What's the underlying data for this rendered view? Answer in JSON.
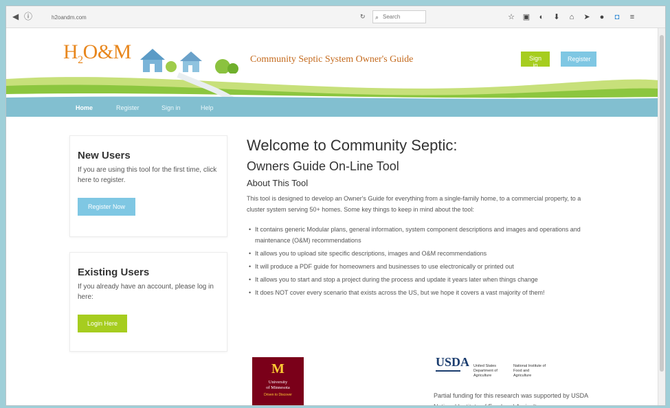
{
  "browser": {
    "url": "h2oandm.com",
    "search_placeholder": "Search"
  },
  "site": {
    "logo": "H₂O&M",
    "tagline": "Community Septic System Owner's Guide",
    "signin_label": "Sign in",
    "register_label": "Register"
  },
  "nav": {
    "items": [
      "Home",
      "Register",
      "Sign in",
      "Help"
    ]
  },
  "new_users": {
    "title": "New Users",
    "text": "If you are using this tool for the first time, click here to register.",
    "button": "Register Now"
  },
  "existing_users": {
    "title": "Existing Users",
    "text": "If you already have an account, please log in here:",
    "button": "Login Here"
  },
  "main": {
    "heading1": "Welcome to Community Septic:",
    "heading2": "Owners Guide On-Line Tool",
    "heading3": "About This Tool",
    "intro": "This tool is designed to develop an Owner's Guide for everything from a single-family home, to a commercial property, to a cluster system serving 50+ homes. Some key things to keep in mind about the tool:",
    "bullets": [
      "It contains generic Modular plans, general information, system component descriptions and images and operations and maintenance (O&M) recommendations",
      "It allows you to upload site specific descriptions, images and O&M recommendations",
      "It will produce a PDF guide for homeowners and businesses to use electronically or printed out",
      "It allows you to start and stop a project during the process and update it years later when things change",
      "It does NOT cover every scenario that exists across the US, but we hope it covers a vast majority of them!"
    ]
  },
  "footer": {
    "umn_name_line1": "University",
    "umn_name_line2": "of Minnesota",
    "umn_slogan": "Driven to Discover",
    "usda": "USDA",
    "usda_dept": "United States Department of Agriculture",
    "nifa": "National Institute of Food and Agriculture",
    "funding": "Partial funding for this research was supported by USDA National Institute of Food and Agriculture"
  },
  "colors": {
    "brand_green": "#a6cd1f",
    "brand_blue": "#7fc7e3",
    "nav_blue": "#82bfd0",
    "logo_orange": "#e8871e",
    "umn_maroon": "#7a0019"
  }
}
